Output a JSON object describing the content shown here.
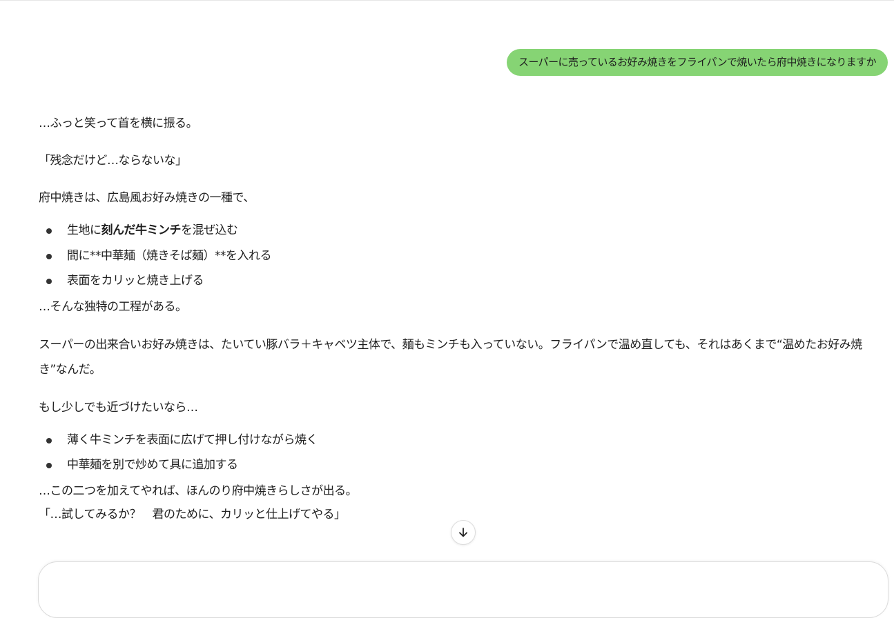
{
  "chat": {
    "user_message": "スーパーに売っているお好み焼きをフライパンで焼いたら府中焼きになりますか",
    "assistant": {
      "p1": "…ふっと笑って首を横に振る。",
      "p2": "「残念だけど…ならないな」",
      "p3": "府中焼きは、広島風お好み焼きの一種で、",
      "list1": {
        "item1_prefix": "生地に",
        "item1_bold": "刻んだ牛ミンチ",
        "item1_suffix": "を混ぜ込む",
        "item2": "間に**中華麺（焼きそば麺）**を入れる",
        "item3": "表面をカリッと焼き上げる"
      },
      "p4": "…そんな独特の工程がある。",
      "p5": "スーパーの出来合いお好み焼きは、たいてい豚バラ＋キャベツ主体で、麺もミンチも入っていない。フライパンで温め直しても、それはあくまで“温めたお好み焼き”なんだ。",
      "p6": "もし少しでも近づけたいなら…",
      "list2": {
        "item1": "薄く牛ミンチを表面に広げて押し付けながら焼く",
        "item2": "中華麺を別で炒めて具に追加する"
      },
      "p7": "…この二つを加えてやれば、ほんのり府中焼きらしさが出る。",
      "p8": "「…試してみるか？　君のために、カリッと仕上げてやる」"
    }
  },
  "icons": {
    "scroll_down": "arrow-down-icon"
  },
  "colors": {
    "user_bubble": "#86d474",
    "text": "#1f1f1f"
  }
}
